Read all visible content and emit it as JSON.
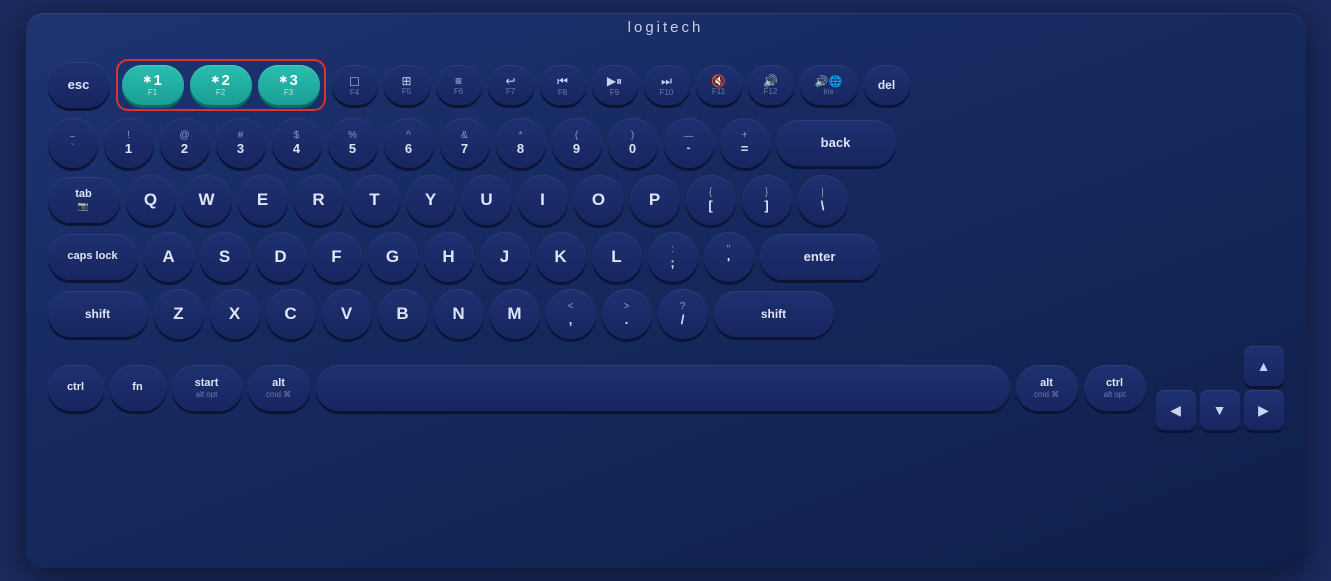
{
  "logo": "logitech",
  "keyboard": {
    "rows": {
      "fn_row": {
        "keys": [
          {
            "id": "esc",
            "label": "esc",
            "type": "esc"
          },
          {
            "id": "bt1",
            "label": "1",
            "fn": "F1",
            "type": "bt"
          },
          {
            "id": "bt2",
            "label": "2",
            "fn": "F2",
            "type": "bt"
          },
          {
            "id": "bt3",
            "label": "3",
            "fn": "F3",
            "type": "bt"
          },
          {
            "id": "f4",
            "label": "F4",
            "icon": "□",
            "type": "fn"
          },
          {
            "id": "f5",
            "label": "F5",
            "icon": "⬜",
            "type": "fn"
          },
          {
            "id": "f6",
            "label": "F6",
            "icon": "≡",
            "type": "fn"
          },
          {
            "id": "f7",
            "label": "F7",
            "icon": "↩",
            "type": "fn"
          },
          {
            "id": "f8",
            "label": "F8",
            "icon": "⏮",
            "type": "fn"
          },
          {
            "id": "f9",
            "label": "F9",
            "icon": "⏯",
            "type": "fn"
          },
          {
            "id": "f10",
            "label": "F10",
            "icon": "⏭",
            "type": "fn"
          },
          {
            "id": "f11",
            "label": "F11",
            "icon": "🔇",
            "type": "fn"
          },
          {
            "id": "f12",
            "label": "F12",
            "icon": "🔊",
            "type": "fn"
          },
          {
            "id": "ins",
            "label": "ins",
            "icon": "🔊",
            "type": "ins"
          },
          {
            "id": "del",
            "label": "del",
            "type": "del"
          }
        ]
      },
      "number_row": {
        "keys": [
          "~`",
          "!1",
          "@2",
          "#3",
          "$4",
          "%5",
          "^6",
          "&7",
          "*8",
          "(9",
          ")0",
          "—-",
          "+=",
          "back"
        ]
      },
      "tab_row": {
        "keys": [
          "tab",
          "Q",
          "W",
          "E",
          "R",
          "T",
          "Y",
          "U",
          "I",
          "O",
          "P",
          "{[",
          "}]",
          "|\\"
        ]
      },
      "caps_row": {
        "keys": [
          "caps lock",
          "A",
          "S",
          "D",
          "F",
          "G",
          "H",
          "J",
          "K",
          "L",
          ";:",
          "\"'",
          "enter"
        ]
      },
      "shift_row": {
        "keys": [
          "shift",
          "Z",
          "X",
          "C",
          "V",
          "B",
          "N",
          "M",
          "<,",
          ">.",
          "?/",
          "shift"
        ]
      },
      "bottom_row": {
        "keys": [
          "ctrl",
          "fn",
          "start\nalt opt",
          "alt\ncmd ⌘",
          "space",
          "alt\ncmd ⌘",
          "ctrl\nalt opt"
        ]
      }
    }
  }
}
